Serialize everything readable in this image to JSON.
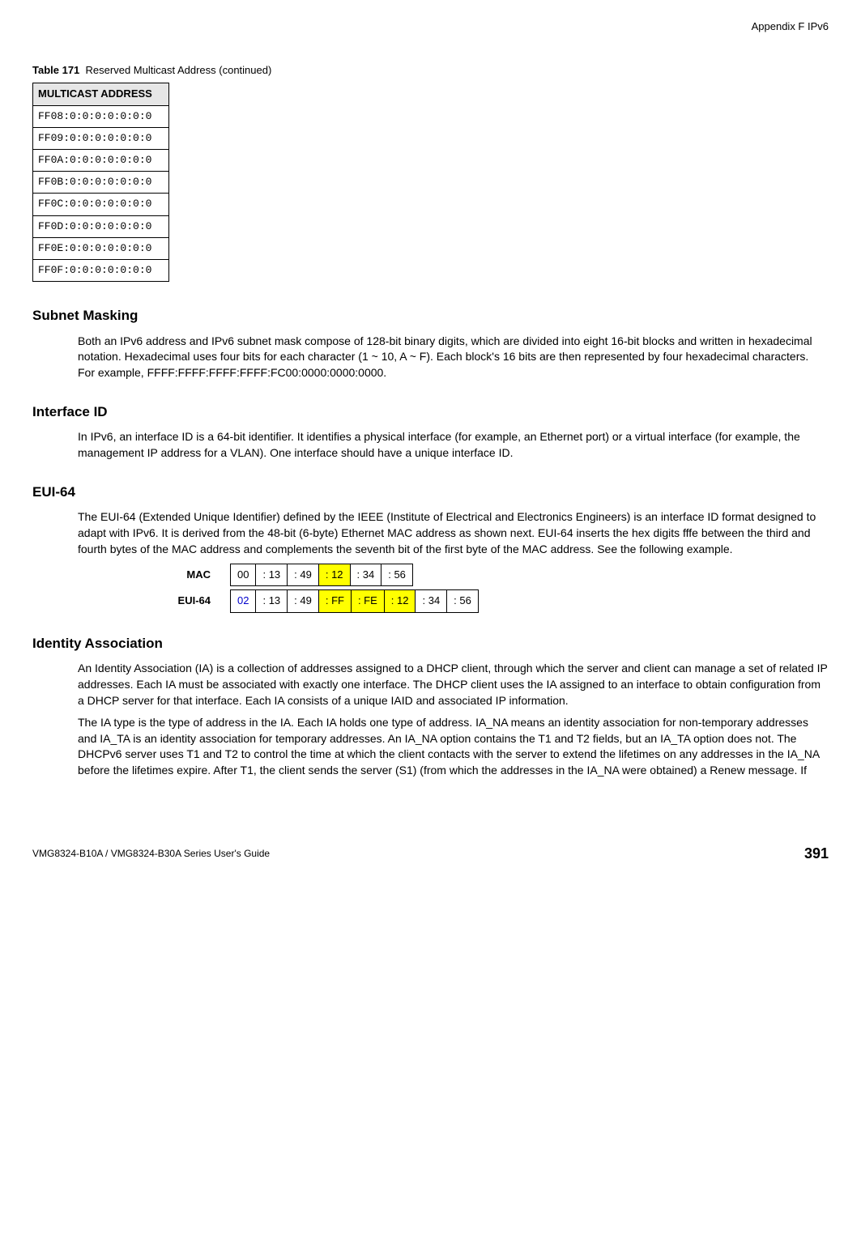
{
  "header": {
    "appendix": "Appendix F IPv6"
  },
  "table171": {
    "caption_label": "Table 171",
    "caption_text": "Reserved Multicast Address (continued)",
    "header": "MULTICAST ADDRESS",
    "rows": [
      "FF08:0:0:0:0:0:0:0",
      "FF09:0:0:0:0:0:0:0",
      "FF0A:0:0:0:0:0:0:0",
      "FF0B:0:0:0:0:0:0:0",
      "FF0C:0:0:0:0:0:0:0",
      "FF0D:0:0:0:0:0:0:0",
      "FF0E:0:0:0:0:0:0:0",
      "FF0F:0:0:0:0:0:0:0"
    ]
  },
  "sections": {
    "subnet_title": "Subnet Masking",
    "subnet_body": "Both an IPv6 address and IPv6 subnet mask compose of 128-bit binary digits, which are divided into eight 16-bit blocks and written in hexadecimal notation. Hexadecimal uses four bits for each character (1 ~ 10, A ~ F). Each block's 16 bits are then represented by four hexadecimal characters. For example, FFFF:FFFF:FFFF:FFFF:FC00:0000:0000:0000.",
    "iface_title": "Interface ID",
    "iface_body": "In IPv6, an interface ID is a 64-bit identifier. It identifies a physical interface (for example, an Ethernet port) or a virtual interface (for example, the management IP address for a VLAN). One interface should have a unique interface ID.",
    "eui_title": "EUI-64",
    "eui_body": "The EUI-64 (Extended Unique Identifier) defined by the IEEE (Institute of Electrical and Electronics Engineers) is an interface ID format designed to adapt with IPv6. It is derived from the 48-bit (6-byte) Ethernet MAC address as shown next. EUI-64 inserts the hex digits fffe between the third and fourth bytes of the MAC address and complements the seventh bit of the first byte of the MAC address. See the following example.",
    "ia_title": "Identity Association",
    "ia_body1": "An Identity Association (IA) is a collection of addresses assigned to a DHCP client, through which the server and client can manage a set of related IP addresses. Each IA must be associated with exactly one interface. The DHCP client uses the IA assigned to an interface to obtain configuration from a DHCP server for that interface. Each IA consists of a unique IAID and associated IP information.",
    "ia_body2": "The IA type is the type of address in the IA. Each IA holds one type of address. IA_NA means an identity association for non-temporary addresses and IA_TA is an identity association for temporary addresses. An IA_NA option contains the T1 and T2 fields, but an IA_TA option does not. The DHCPv6 server uses T1 and T2 to control the time at which the client contacts with the server to extend the lifetimes on any addresses in the IA_NA before the lifetimes expire. After T1, the client sends the server (S1) (from which the addresses in the IA_NA were obtained) a Renew message. If"
  },
  "eui": {
    "mac_label": "MAC",
    "eui_label": "EUI-64",
    "mac": [
      "00",
      ": 13",
      ": 49",
      ": 12",
      ": 34",
      ": 56"
    ],
    "eui64": [
      "02",
      ": 13",
      ": 49",
      ": FF",
      ": FE",
      ": 12",
      ": 34",
      ": 56"
    ]
  },
  "footer": {
    "left": "VMG8324-B10A / VMG8324-B30A Series User's Guide",
    "page": "391"
  }
}
